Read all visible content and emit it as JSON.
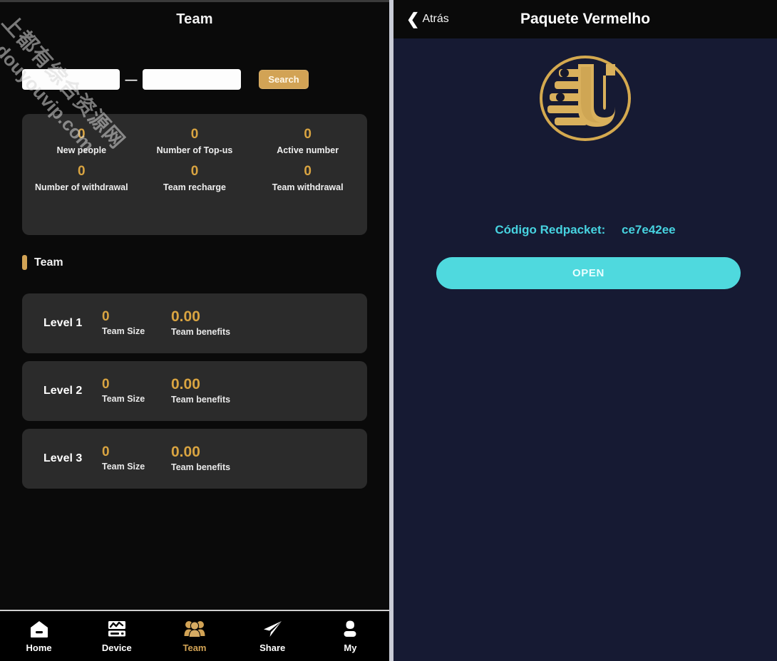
{
  "left": {
    "title": "Team",
    "search": {
      "start_value": "",
      "start_placeholder": "",
      "separator": "—",
      "end_value": "",
      "end_placeholder": "",
      "button_label": "Search"
    },
    "stats": [
      {
        "value": "0",
        "label": "New people"
      },
      {
        "value": "0",
        "label": "Number of Top-us"
      },
      {
        "value": "0",
        "label": "Active number"
      },
      {
        "value": "0",
        "label": "Number of withdrawal"
      },
      {
        "value": "0",
        "label": "Team recharge"
      },
      {
        "value": "0",
        "label": "Team withdrawal"
      }
    ],
    "section_title": "Team",
    "levels": [
      {
        "name": "Level 1",
        "size_value": "0",
        "size_label": "Team Size",
        "benefit_value": "0.00",
        "benefit_label": "Team benefits"
      },
      {
        "name": "Level 2",
        "size_value": "0",
        "size_label": "Team Size",
        "benefit_value": "0.00",
        "benefit_label": "Team benefits"
      },
      {
        "name": "Level 3",
        "size_value": "0",
        "size_label": "Team Size",
        "benefit_value": "0.00",
        "benefit_label": "Team benefits"
      }
    ],
    "nav": [
      {
        "label": "Home",
        "icon": "home-icon",
        "active": false
      },
      {
        "label": "Device",
        "icon": "device-icon",
        "active": false
      },
      {
        "label": "Team",
        "icon": "team-icon",
        "active": true
      },
      {
        "label": "Share",
        "icon": "share-paperplane-icon",
        "active": false
      },
      {
        "label": "My",
        "icon": "user-profile-icon",
        "active": false
      }
    ],
    "watermark": {
      "chinese": "上都有综合资源网",
      "domain": "douyouvip.com"
    }
  },
  "right": {
    "back_label": "Atrás",
    "title": "Paquete Vermelho",
    "logo_alt": "gold-circle-u-logo",
    "code_label": "Código Redpacket:",
    "code_value": "ce7e42ee",
    "open_label": "OPEN"
  },
  "colors": {
    "gold": "#d2a355",
    "gold_value": "#d9a441",
    "cyan": "#4fd9de",
    "cyan_text": "#47d3e0",
    "left_bg": "#0a0a0a",
    "card_bg": "#2b2b2b",
    "right_bg": "#161a33",
    "header_bg": "#0a0a0a"
  }
}
